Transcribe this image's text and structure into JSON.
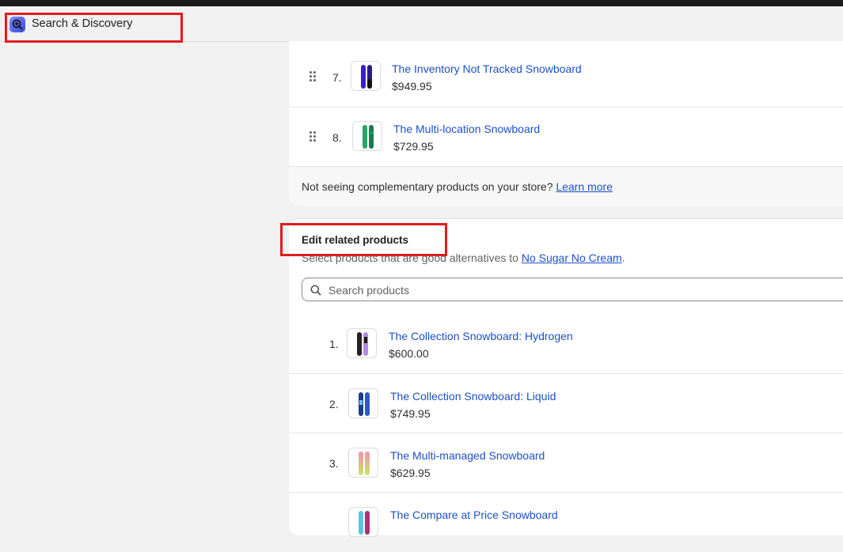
{
  "app": {
    "title": "Search & Discovery",
    "icon": "search-discovery-app-icon"
  },
  "complementary": {
    "items": [
      {
        "index": "7.",
        "name": "The Inventory Not Tracked Snowboard",
        "price": "$949.95",
        "thumb": "snowboard-purple-thumbnail"
      },
      {
        "index": "8.",
        "name": "The Multi-location Snowboard",
        "price": "$729.95",
        "thumb": "snowboard-green-thumbnail"
      }
    ],
    "footer_text": "Not seeing complementary products on your store?",
    "footer_link": "Learn more"
  },
  "related": {
    "title": "Edit related products",
    "subtitle_prefix": "Select products that are good alternatives to",
    "subtitle_link": "No Sugar No Cream",
    "subtitle_suffix": ".",
    "search_placeholder": "Search products",
    "items": [
      {
        "index": "1.",
        "name": "The Collection Snowboard: Hydrogen",
        "price": "$600.00",
        "thumb": "snowboard-hydrogen-thumbnail"
      },
      {
        "index": "2.",
        "name": "The Collection Snowboard: Liquid",
        "price": "$749.95",
        "thumb": "snowboard-liquid-thumbnail"
      },
      {
        "index": "3.",
        "name": "The Multi-managed Snowboard",
        "price": "$629.95",
        "thumb": "snowboard-pastel-thumbnail"
      },
      {
        "index": "",
        "name": "The Compare at Price Snowboard",
        "price": "",
        "thumb": "snowboard-compare-thumbnail"
      }
    ]
  },
  "colors": {
    "highlight": "#e31b1b",
    "link": "#1d4fc4"
  }
}
